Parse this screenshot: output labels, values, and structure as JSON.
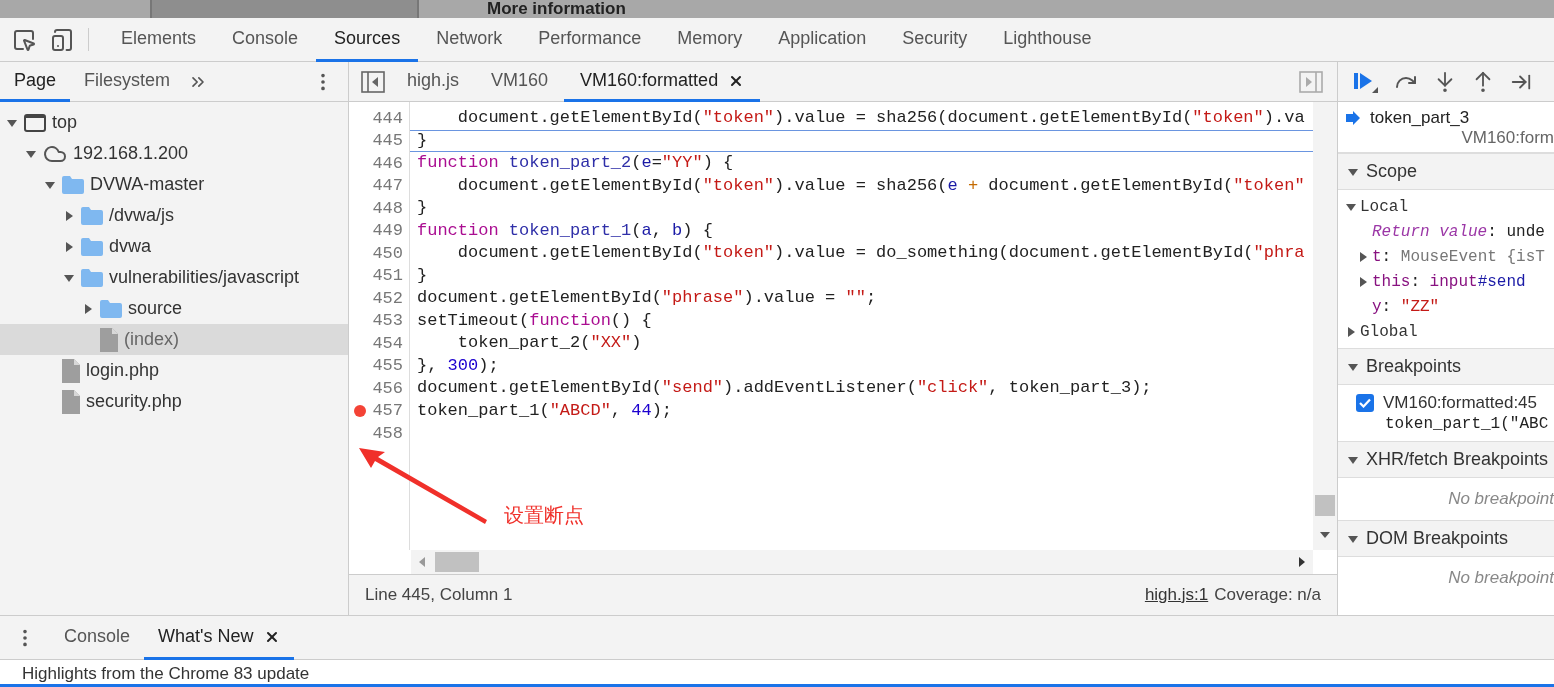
{
  "page_behind": {
    "heading": "More information"
  },
  "toolbar": {
    "tabs": [
      {
        "label": "Elements",
        "selected": false
      },
      {
        "label": "Console",
        "selected": false
      },
      {
        "label": "Sources",
        "selected": true
      },
      {
        "label": "Network",
        "selected": false
      },
      {
        "label": "Performance",
        "selected": false
      },
      {
        "label": "Memory",
        "selected": false
      },
      {
        "label": "Application",
        "selected": false
      },
      {
        "label": "Security",
        "selected": false
      },
      {
        "label": "Lighthouse",
        "selected": false
      }
    ]
  },
  "navigator": {
    "tabs": [
      {
        "label": "Page",
        "selected": true
      },
      {
        "label": "Filesystem",
        "selected": false
      }
    ],
    "tree": [
      {
        "kind": "frame",
        "label": "top",
        "expanded": true,
        "selected": false,
        "children": [
          {
            "kind": "domain",
            "label": "192.168.1.200",
            "expanded": true,
            "selected": false,
            "children": [
              {
                "kind": "folder",
                "label": "DVWA-master",
                "expanded": true,
                "selected": false,
                "children": [
                  {
                    "kind": "folder",
                    "label": "/dvwa/js",
                    "expanded": false,
                    "selected": false
                  },
                  {
                    "kind": "folder",
                    "label": "dvwa",
                    "expanded": false,
                    "selected": false
                  },
                  {
                    "kind": "folder",
                    "label": "vulnerabilities/javascript",
                    "expanded": true,
                    "selected": false,
                    "children": [
                      {
                        "kind": "folder",
                        "label": "source",
                        "expanded": false,
                        "selected": false
                      },
                      {
                        "kind": "file",
                        "label": "(index)",
                        "selected": true
                      }
                    ]
                  }
                ]
              },
              {
                "kind": "file",
                "label": "login.php",
                "selected": false
              },
              {
                "kind": "file",
                "label": "security.php",
                "selected": false
              }
            ]
          }
        ]
      }
    ]
  },
  "editor": {
    "tabs": [
      {
        "label": "high.js",
        "selected": false,
        "closable": false
      },
      {
        "label": "VM160",
        "selected": false,
        "closable": false
      },
      {
        "label": "VM160:formatted",
        "selected": true,
        "closable": true
      }
    ],
    "lines": [
      {
        "number": "444",
        "current": false,
        "breakpoint": false,
        "tokens": [
          {
            "kind": "plain",
            "text": "    document.getElementById("
          },
          {
            "kind": "string",
            "text": "\"token\""
          },
          {
            "kind": "plain",
            "text": ").value = sha256(document.getElementById("
          },
          {
            "kind": "string",
            "text": "\"token\""
          },
          {
            "kind": "plain",
            "text": ").va"
          }
        ]
      },
      {
        "number": "445",
        "current": true,
        "breakpoint": false,
        "tokens": [
          {
            "kind": "plain",
            "text": "}"
          }
        ]
      },
      {
        "number": "446",
        "current": false,
        "breakpoint": false,
        "tokens": [
          {
            "kind": "keyword",
            "text": "function "
          },
          {
            "kind": "def",
            "text": "token_part_2"
          },
          {
            "kind": "plain",
            "text": "("
          },
          {
            "kind": "param",
            "text": "e"
          },
          {
            "kind": "plain",
            "text": "="
          },
          {
            "kind": "string",
            "text": "\"YY\""
          },
          {
            "kind": "plain",
            "text": ") {"
          }
        ]
      },
      {
        "number": "447",
        "current": false,
        "breakpoint": false,
        "tokens": [
          {
            "kind": "plain",
            "text": "    document.getElementById("
          },
          {
            "kind": "string",
            "text": "\"token\""
          },
          {
            "kind": "plain",
            "text": ").value = sha256("
          },
          {
            "kind": "param",
            "text": "e"
          },
          {
            "kind": "operator",
            "text": " + "
          },
          {
            "kind": "plain",
            "text": "document.getElementById("
          },
          {
            "kind": "string",
            "text": "\"token\""
          }
        ]
      },
      {
        "number": "448",
        "current": false,
        "breakpoint": false,
        "tokens": [
          {
            "kind": "plain",
            "text": "}"
          }
        ]
      },
      {
        "number": "449",
        "current": false,
        "breakpoint": false,
        "tokens": [
          {
            "kind": "keyword",
            "text": "function "
          },
          {
            "kind": "def",
            "text": "token_part_1"
          },
          {
            "kind": "plain",
            "text": "("
          },
          {
            "kind": "param",
            "text": "a"
          },
          {
            "kind": "plain",
            "text": ", "
          },
          {
            "kind": "param",
            "text": "b"
          },
          {
            "kind": "plain",
            "text": ") {"
          }
        ]
      },
      {
        "number": "450",
        "current": false,
        "breakpoint": false,
        "tokens": [
          {
            "kind": "plain",
            "text": "    document.getElementById("
          },
          {
            "kind": "string",
            "text": "\"token\""
          },
          {
            "kind": "plain",
            "text": ").value = do_something(document.getElementById("
          },
          {
            "kind": "string",
            "text": "\"phra"
          }
        ]
      },
      {
        "number": "451",
        "current": false,
        "breakpoint": false,
        "tokens": [
          {
            "kind": "plain",
            "text": "}"
          }
        ]
      },
      {
        "number": "452",
        "current": false,
        "breakpoint": false,
        "tokens": [
          {
            "kind": "plain",
            "text": "document.getElementById("
          },
          {
            "kind": "string",
            "text": "\"phrase\""
          },
          {
            "kind": "plain",
            "text": ").value = "
          },
          {
            "kind": "string",
            "text": "\"\""
          },
          {
            "kind": "plain",
            "text": ";"
          }
        ]
      },
      {
        "number": "453",
        "current": false,
        "breakpoint": false,
        "tokens": [
          {
            "kind": "plain",
            "text": "setTimeout("
          },
          {
            "kind": "keyword",
            "text": "function"
          },
          {
            "kind": "plain",
            "text": "() {"
          }
        ]
      },
      {
        "number": "454",
        "current": false,
        "breakpoint": false,
        "tokens": [
          {
            "kind": "plain",
            "text": "    token_part_2("
          },
          {
            "kind": "string",
            "text": "\"XX\""
          },
          {
            "kind": "plain",
            "text": ")"
          }
        ]
      },
      {
        "number": "455",
        "current": false,
        "breakpoint": false,
        "tokens": [
          {
            "kind": "plain",
            "text": "}, "
          },
          {
            "kind": "number",
            "text": "300"
          },
          {
            "kind": "plain",
            "text": ");"
          }
        ]
      },
      {
        "number": "456",
        "current": false,
        "breakpoint": false,
        "tokens": [
          {
            "kind": "plain",
            "text": "document.getElementById("
          },
          {
            "kind": "string",
            "text": "\"send\""
          },
          {
            "kind": "plain",
            "text": ").addEventListener("
          },
          {
            "kind": "string",
            "text": "\"click\""
          },
          {
            "kind": "plain",
            "text": ", token_part_3);"
          }
        ]
      },
      {
        "number": "457",
        "current": false,
        "breakpoint": true,
        "tokens": [
          {
            "kind": "plain",
            "text": "token_part_1("
          },
          {
            "kind": "string",
            "text": "\"ABCD\""
          },
          {
            "kind": "plain",
            "text": ", "
          },
          {
            "kind": "number",
            "text": "44"
          },
          {
            "kind": "plain",
            "text": ");"
          }
        ]
      },
      {
        "number": "458",
        "current": false,
        "breakpoint": false
      }
    ],
    "annotation": {
      "text": "设置断点"
    },
    "status": {
      "position": "Line 445, Column 1",
      "link": "high.js:1",
      "coverage": "Coverage: n/a"
    }
  },
  "debugger": {
    "call_stack": [
      {
        "name": "token_part_3",
        "location": "VM160:form",
        "selected": true
      }
    ],
    "sections": [
      {
        "kind": "scope",
        "title": "Scope",
        "expanded": true,
        "groups": [
          {
            "label": "Local",
            "expanded": true,
            "vars": [
              {
                "expandable": false,
                "tokens": [
                  {
                    "kind": "special",
                    "text": "Return value"
                  },
                  {
                    "kind": "plain",
                    "text": ": unde"
                  }
                ]
              },
              {
                "expandable": true,
                "tokens": [
                  {
                    "kind": "name",
                    "text": "t"
                  },
                  {
                    "kind": "plain",
                    "text": ": "
                  },
                  {
                    "kind": "muted",
                    "text": "MouseEvent {isT"
                  }
                ]
              },
              {
                "expandable": true,
                "tokens": [
                  {
                    "kind": "name",
                    "text": "this"
                  },
                  {
                    "kind": "plain",
                    "text": ": "
                  },
                  {
                    "kind": "name",
                    "text": "input"
                  },
                  {
                    "kind": "selector",
                    "text": "#send"
                  }
                ]
              },
              {
                "expandable": false,
                "tokens": [
                  {
                    "kind": "name",
                    "text": "y"
                  },
                  {
                    "kind": "plain",
                    "text": ": "
                  },
                  {
                    "kind": "string",
                    "text": "\"ZZ\""
                  }
                ]
              }
            ]
          },
          {
            "label": "Global",
            "expanded": false
          }
        ]
      },
      {
        "kind": "breakpoints",
        "title": "Breakpoints",
        "expanded": true,
        "items": [
          {
            "checked": true,
            "location": "VM160:formatted:45",
            "code": "token_part_1(\"ABC"
          }
        ]
      },
      {
        "kind": "empty",
        "title": "XHR/fetch Breakpoints",
        "expanded": true,
        "message": "No breakpoint"
      },
      {
        "kind": "empty",
        "title": "DOM Breakpoints",
        "expanded": true,
        "message": "No breakpoint"
      }
    ]
  },
  "drawer": {
    "tabs": [
      {
        "label": "Console",
        "selected": false,
        "closable": false
      },
      {
        "label": "What's New",
        "selected": true,
        "closable": true
      }
    ],
    "text": "Highlights from the Chrome 83 update"
  }
}
